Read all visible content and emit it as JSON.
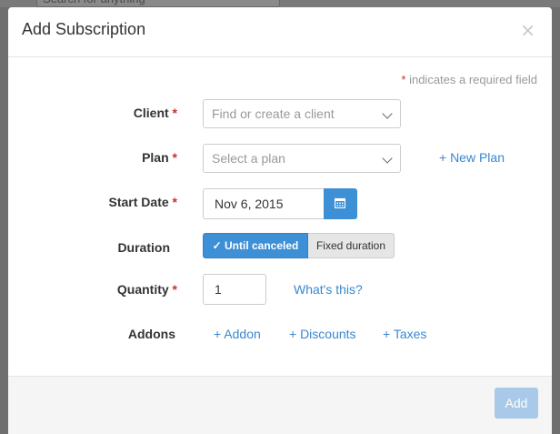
{
  "backdrop": {
    "search_placeholder": "Search for anything"
  },
  "modal": {
    "title": "Add Subscription",
    "close_label": "×",
    "required_note_star": "*",
    "required_note_text": "indicates a required field"
  },
  "form": {
    "client": {
      "label": "Client",
      "star": "*",
      "placeholder": "Find or create a client"
    },
    "plan": {
      "label": "Plan",
      "star": "*",
      "placeholder": "Select a plan",
      "new_plan": "+ New Plan"
    },
    "start_date": {
      "label": "Start Date",
      "star": "*",
      "value": "Nov 6, 2015"
    },
    "duration": {
      "label": "Duration",
      "options": [
        "✓ Until canceled",
        "Fixed duration"
      ],
      "selected": "Until canceled"
    },
    "quantity": {
      "label": "Quantity",
      "star": "*",
      "value": "1",
      "help_link": "What's this?"
    },
    "addons": {
      "label": "Addons",
      "links": [
        "+ Addon",
        "+ Discounts",
        "+ Taxes"
      ]
    }
  },
  "footer": {
    "add_label": "Add"
  },
  "colors": {
    "accent": "#3d8fd6",
    "link": "#3a87d0",
    "required": "#c9302c",
    "add_disabled": "#a9c9e8"
  },
  "icons": {
    "calendar": "calendar-icon",
    "chevron": "chevron-down-icon",
    "close": "close-icon"
  }
}
